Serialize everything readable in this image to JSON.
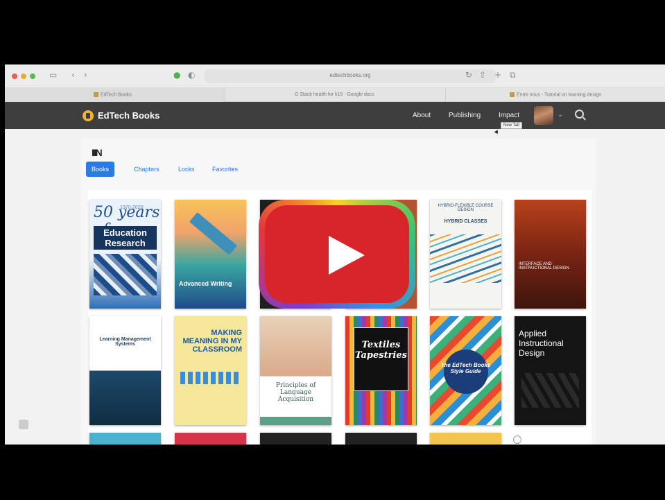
{
  "browser": {
    "url": "edtechbooks.org",
    "tabs": [
      {
        "label": "EdTech Books"
      },
      {
        "label": "G  Stack health for k19 · Google docs"
      },
      {
        "label": "Entre nous - Tutorial on learning design"
      }
    ]
  },
  "header": {
    "logo_text": "EdTech Books",
    "nav": [
      "About",
      "Publishing",
      "Impact"
    ],
    "tooltip": "New Tab"
  },
  "library": {
    "icon": "IIIN",
    "tabs": [
      {
        "label": "Books",
        "active": true
      },
      {
        "label": "Chapters",
        "active": false
      },
      {
        "label": "Locks",
        "active": false
      },
      {
        "label": "Favorites",
        "active": false
      }
    ]
  },
  "books": [
    {
      "title": "Education Research",
      "subtitle": "50 years of",
      "top_text": "1970-2020"
    },
    {
      "title": "Advanced Writing"
    },
    {
      "title": ""
    },
    {
      "title": "HYBRID CLASSES",
      "top_text": "HYBRID-FLEXIBLE COURSE DESIGN"
    },
    {
      "title": "INTERFACE AND INSTRUCTIONAL DESIGN"
    },
    {
      "title": "Learning Management Systems"
    },
    {
      "title": "MAKING MEANING IN MY CLASSROOM"
    },
    {
      "title": "Principles of Language Acquisition"
    },
    {
      "title": "Textiles Tapestries"
    },
    {
      "title": "The EdTech Books Style Guide"
    },
    {
      "title": "Applied Instructional Design"
    }
  ],
  "colors": {
    "accent": "#2c7be5",
    "header_bg": "#3e3e3e",
    "play_red": "#d9252a"
  },
  "icons": {
    "play": "play-icon",
    "search": "search-icon",
    "shelf": "bookshelf-icon"
  }
}
